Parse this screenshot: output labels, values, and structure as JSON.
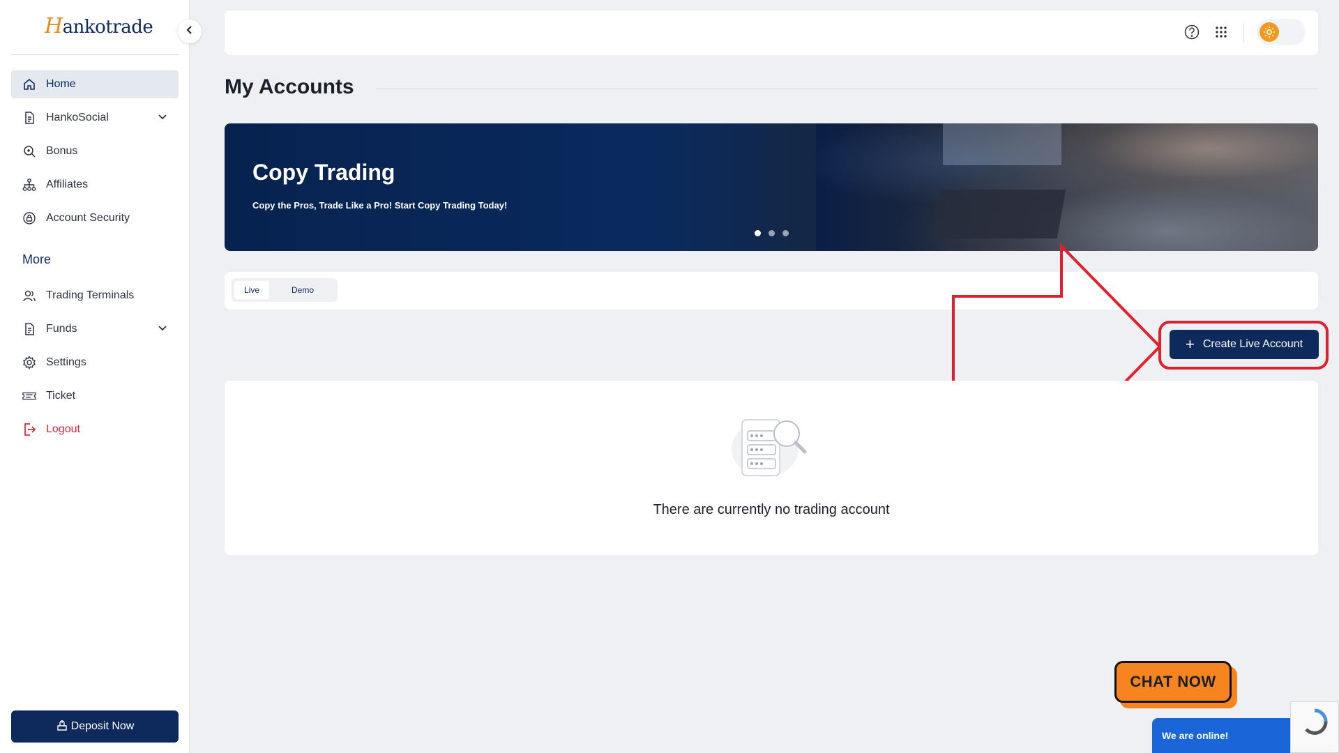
{
  "brand": {
    "logo_initial": "H",
    "logo_rest": "ankotrade"
  },
  "sidebar": {
    "items": [
      {
        "label": "Home",
        "icon": "home-icon",
        "active": true
      },
      {
        "label": "HankoSocial",
        "icon": "document-icon",
        "has_submenu": true
      },
      {
        "label": "Bonus",
        "icon": "bonus-icon"
      },
      {
        "label": "Affiliates",
        "icon": "network-icon"
      },
      {
        "label": "Account Security",
        "icon": "shield-icon"
      }
    ],
    "section_title": "More",
    "more_items": [
      {
        "label": "Trading Terminals",
        "icon": "users-icon"
      },
      {
        "label": "Funds",
        "icon": "wallet-icon",
        "has_submenu": true
      },
      {
        "label": "Settings",
        "icon": "gear-icon"
      },
      {
        "label": "Ticket",
        "icon": "ticket-icon"
      },
      {
        "label": "Logout",
        "icon": "logout-icon",
        "color": "#d7263d"
      }
    ],
    "deposit_label": "Deposit Now"
  },
  "topbar": {
    "icons": [
      "help-icon",
      "apps-grid-icon",
      "sun-icon"
    ],
    "theme": "light"
  },
  "page": {
    "title": "My Accounts"
  },
  "banner": {
    "title": "Copy Trading",
    "subtitle": "Copy the Pros, Trade Like a Pro! Start Copy Trading Today!",
    "slides": 3,
    "active_slide": 1
  },
  "tabs": [
    {
      "label": "Live",
      "active": true
    },
    {
      "label": "Demo",
      "active": false
    }
  ],
  "actions": {
    "create_label": "Create Live Account"
  },
  "empty_state": {
    "message": "There are currently no trading account"
  },
  "chat": {
    "cta": "CHAT NOW",
    "status": "We are online!"
  },
  "colors": {
    "primary": "#0e2a5c",
    "accent": "#f29a1f",
    "danger": "#d7263d",
    "annotation": "#e0202c",
    "chat_blue": "#1a66d9",
    "chat_orange": "#f6851f"
  }
}
